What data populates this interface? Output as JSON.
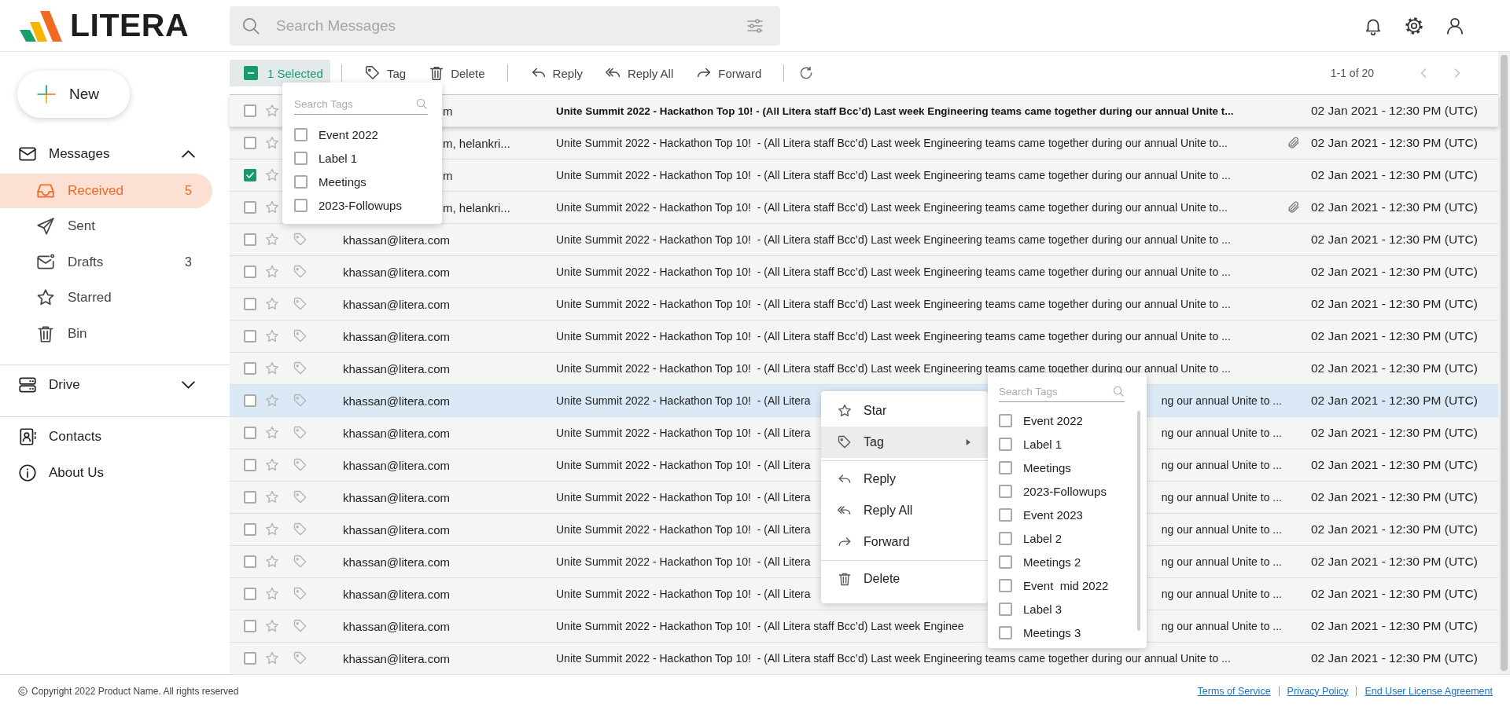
{
  "brand": {
    "name": "LITERA"
  },
  "search": {
    "placeholder": "Search Messages"
  },
  "new_button": {
    "label": "New"
  },
  "sidebar": {
    "messages": {
      "label": "Messages",
      "expanded": true,
      "items": [
        {
          "label": "Received",
          "count": "5",
          "selected": true
        },
        {
          "label": "Sent",
          "selected": false
        },
        {
          "label": "Drafts",
          "count": "3",
          "selected": false
        },
        {
          "label": "Starred",
          "selected": false
        },
        {
          "label": "Bin",
          "selected": false
        }
      ]
    },
    "drive": {
      "label": "Drive",
      "expanded": false
    },
    "links": [
      {
        "label": "Contacts"
      },
      {
        "label": "About Us"
      }
    ]
  },
  "toolbar": {
    "selection": {
      "label": "1 Selected",
      "open": true
    },
    "actions": [
      {
        "label": "Tag"
      },
      {
        "label": "Delete"
      },
      {
        "label": "Reply"
      },
      {
        "label": "Reply All"
      },
      {
        "label": "Forward"
      }
    ],
    "pagination": "1-1 of 20"
  },
  "messages": [
    {
      "checked": false,
      "starred": false,
      "unread": true,
      "highlighted": false,
      "sender": "m",
      "subject": "Unite Summit 2022 - Hackathon Top 10! - (All Litera staff Bcc’d) Last week Engineering teams came together during our annual Unite t...",
      "attachment": false,
      "date": "02 Jan 2021 - 12:30 PM (UTC)"
    },
    {
      "checked": false,
      "starred": false,
      "unread": false,
      "highlighted": false,
      "sender": "m, helankri...",
      "subject": "Unite Summit 2022 - Hackathon Top 10!  - (All Litera staff Bcc’d) Last week Engineering teams came together during our annual Unite to...",
      "attachment": true,
      "date": "02 Jan 2021 - 12:30 PM (UTC)"
    },
    {
      "checked": true,
      "starred": false,
      "unread": false,
      "highlighted": false,
      "sender": "m",
      "subject": "Unite Summit 2022 - Hackathon Top 10!  - (All Litera staff Bcc’d) Last week Engineering teams came together during our annual Unite to ...",
      "attachment": false,
      "date": "02 Jan 2021 - 12:30 PM (UTC)"
    },
    {
      "checked": false,
      "starred": false,
      "unread": false,
      "highlighted": false,
      "sender": "m, helankri...",
      "subject": "Unite Summit 2022 - Hackathon Top 10!  - (All Litera staff Bcc’d) Last week Engineering teams came together during our annual Unite to...",
      "attachment": true,
      "date": "02 Jan 2021 - 12:30 PM (UTC)"
    },
    {
      "checked": false,
      "starred": false,
      "unread": false,
      "highlighted": false,
      "sender": "khassan@litera.com",
      "subject": "Unite Summit 2022 - Hackathon Top 10!  - (All Litera staff Bcc’d) Last week Engineering teams came together during our annual Unite to ...",
      "attachment": false,
      "date": "02 Jan 2021 - 12:30 PM (UTC)"
    },
    {
      "checked": false,
      "starred": false,
      "unread": false,
      "highlighted": false,
      "sender": "khassan@litera.com",
      "subject": "Unite Summit 2022 - Hackathon Top 10!  - (All Litera staff Bcc’d) Last week Engineering teams came together during our annual Unite to ...",
      "attachment": false,
      "date": "02 Jan 2021 - 12:30 PM (UTC)"
    },
    {
      "checked": false,
      "starred": false,
      "unread": false,
      "highlighted": false,
      "sender": "khassan@litera.com",
      "subject": "Unite Summit 2022 - Hackathon Top 10!  - (All Litera staff Bcc’d) Last week Engineering teams came together during our annual Unite to ...",
      "attachment": false,
      "date": "02 Jan 2021 - 12:30 PM (UTC)"
    },
    {
      "checked": false,
      "starred": false,
      "unread": false,
      "highlighted": false,
      "sender": "khassan@litera.com",
      "subject": "Unite Summit 2022 - Hackathon Top 10!  - (All Litera staff Bcc’d) Last week Engineering teams came together during our annual Unite to ...",
      "attachment": false,
      "date": "02 Jan 2021 - 12:30 PM (UTC)"
    },
    {
      "checked": false,
      "starred": false,
      "unread": false,
      "highlighted": false,
      "sender": "khassan@litera.com",
      "subject": "Unite Summit 2022 - Hackathon Top 10!  - (All Litera staff Bcc’d) Last week Engineering teams came together during our annual Unite to ...",
      "attachment": false,
      "date": "02 Jan 2021 - 12:30 PM (UTC)"
    },
    {
      "checked": false,
      "starred": false,
      "unread": false,
      "highlighted": true,
      "sender": "khassan@litera.com",
      "subject": "Unite Summit 2022 - Hackathon Top 10!  - (All Litera",
      "subject_tail": "ng our annual Unite to ...",
      "attachment": false,
      "date": "02 Jan 2021 - 12:30 PM (UTC)"
    },
    {
      "checked": false,
      "starred": false,
      "unread": false,
      "highlighted": false,
      "sender": "khassan@litera.com",
      "subject": "Unite Summit 2022 - Hackathon Top 10!  - (All Litera",
      "subject_tail": "ng our annual Unite to ...",
      "attachment": false,
      "date": "02 Jan 2021 - 12:30 PM (UTC)"
    },
    {
      "checked": false,
      "starred": false,
      "unread": false,
      "highlighted": false,
      "sender": "khassan@litera.com",
      "subject": "Unite Summit 2022 - Hackathon Top 10!  - (All Litera",
      "subject_tail": "ng our annual Unite to ...",
      "attachment": false,
      "date": "02 Jan 2021 - 12:30 PM (UTC)"
    },
    {
      "checked": false,
      "starred": false,
      "unread": false,
      "highlighted": false,
      "sender": "khassan@litera.com",
      "subject": "Unite Summit 2022 - Hackathon Top 10!  - (All Litera",
      "subject_tail": "ng our annual Unite to ...",
      "attachment": false,
      "date": "02 Jan 2021 - 12:30 PM (UTC)"
    },
    {
      "checked": false,
      "starred": false,
      "unread": false,
      "highlighted": false,
      "sender": "khassan@litera.com",
      "subject": "Unite Summit 2022 - Hackathon Top 10!  - (All Litera",
      "subject_tail": "ng our annual Unite to ...",
      "attachment": false,
      "date": "02 Jan 2021 - 12:30 PM (UTC)"
    },
    {
      "checked": false,
      "starred": false,
      "unread": false,
      "highlighted": false,
      "sender": "khassan@litera.com",
      "subject": "Unite Summit 2022 - Hackathon Top 10!  - (All Litera",
      "subject_tail": "ng our annual Unite to ...",
      "attachment": false,
      "date": "02 Jan 2021 - 12:30 PM (UTC)"
    },
    {
      "checked": false,
      "starred": false,
      "unread": false,
      "highlighted": false,
      "sender": "khassan@litera.com",
      "subject": "Unite Summit 2022 - Hackathon Top 10!  - (All Litera",
      "subject_tail": "ng our annual Unite to ...",
      "attachment": false,
      "date": "02 Jan 2021 - 12:30 PM (UTC)"
    },
    {
      "checked": false,
      "starred": false,
      "unread": false,
      "highlighted": false,
      "sender": "khassan@litera.com",
      "subject": "Unite Summit 2022 - Hackathon Top 10!  - (All Litera staff Bcc’d) Last week Enginee",
      "subject_tail": "ng our annual Unite to ...",
      "attachment": false,
      "date": "02 Jan 2021 - 12:30 PM (UTC)"
    },
    {
      "checked": false,
      "starred": false,
      "unread": false,
      "highlighted": false,
      "sender": "khassan@litera.com",
      "subject": "Unite Summit 2022 - Hackathon Top 10!  - (All Litera staff Bcc’d) Last week Engineering teams came together during our annual Unite to ...",
      "attachment": false,
      "date": "02 Jan 2021 - 12:30 PM (UTC)"
    }
  ],
  "tag_dropdown": {
    "placeholder": "Search Tags",
    "tags": [
      {
        "label": "Event 2022",
        "checked": false
      },
      {
        "label": "Label 1",
        "checked": false
      },
      {
        "label": "Meetings",
        "checked": false
      },
      {
        "label": "2023-Followups",
        "checked": false
      }
    ]
  },
  "context_menu": {
    "groups": [
      {
        "items": [
          {
            "label": "Star",
            "selected": false,
            "submenu": false
          },
          {
            "label": "Tag",
            "selected": true,
            "submenu": true
          }
        ]
      },
      {
        "items": [
          {
            "label": "Reply",
            "selected": false,
            "submenu": false
          },
          {
            "label": "Reply All",
            "selected": false,
            "submenu": false
          },
          {
            "label": "Forward",
            "selected": false,
            "submenu": false
          }
        ]
      },
      {
        "items": [
          {
            "label": "Delete",
            "selected": false,
            "submenu": false
          }
        ]
      }
    ]
  },
  "tag_panel": {
    "placeholder": "Search Tags",
    "tags": [
      {
        "label": "Event 2022",
        "checked": false
      },
      {
        "label": "Label 1",
        "checked": false
      },
      {
        "label": "Meetings",
        "checked": false
      },
      {
        "label": "2023-Followups",
        "checked": false
      },
      {
        "label": "Event 2023",
        "checked": false
      },
      {
        "label": "Label 2",
        "checked": false
      },
      {
        "label": "Meetings 2",
        "checked": false
      },
      {
        "label": "Event  mid 2022",
        "checked": false
      },
      {
        "label": "Label 3",
        "checked": false
      },
      {
        "label": "Meetings 3",
        "checked": false
      }
    ]
  },
  "footer": {
    "copyright": "Copyright 2022 Product Name. All rights reserved",
    "links": [
      "Terms of Service",
      "Privacy Policy",
      "End User License Agreement"
    ]
  }
}
